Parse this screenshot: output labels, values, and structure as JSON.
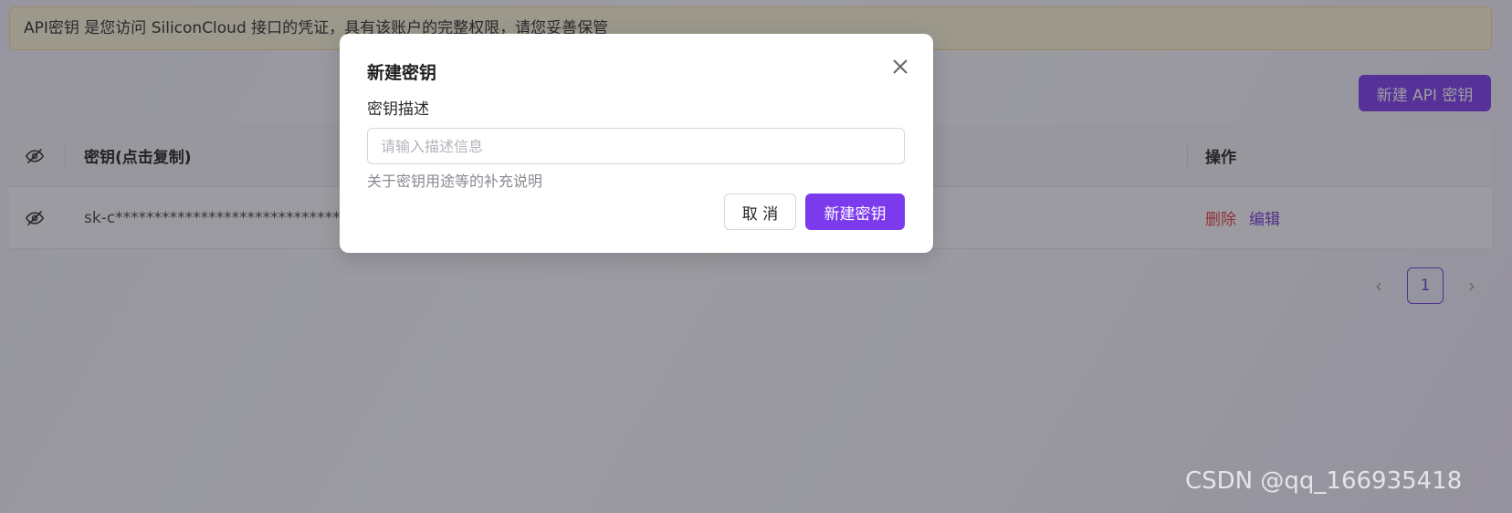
{
  "notice": {
    "text": "API密钥 是您访问 SiliconCloud 接口的凭证，具有该账户的完整权限，请您妥善保管"
  },
  "toolbar": {
    "new_key_label": "新建 API 密钥"
  },
  "table": {
    "headers": {
      "key": "密钥(点击复制)",
      "ops": "操作"
    },
    "rows": [
      {
        "key": "sk-c**********************************",
        "delete": "删除",
        "edit": "编辑"
      }
    ]
  },
  "pagination": {
    "current": "1",
    "prev_icon": "‹",
    "next_icon": "›"
  },
  "modal": {
    "title": "新建密钥",
    "field_label": "密钥描述",
    "input_placeholder": "请输入描述信息",
    "input_value": "",
    "help_text": "关于密钥用途等的补充说明",
    "cancel_label": "取 消",
    "create_label": "新建密钥"
  },
  "watermark": {
    "text": "CSDN @qq_166935418"
  },
  "colors": {
    "accent": "#7c3aed",
    "danger": "#e23b3b",
    "notice_bg": "#fcf4d8"
  },
  "icons": [
    "eye-off-icon",
    "close-icon",
    "chevron-left-icon",
    "chevron-right-icon"
  ]
}
